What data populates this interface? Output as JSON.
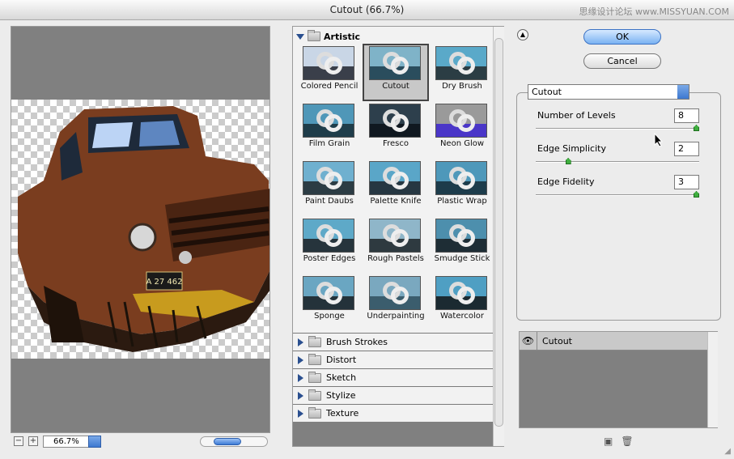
{
  "window": {
    "title": "Cutout (66.7%)",
    "watermark": "思缘设计论坛 www.MISSYUAN.COM"
  },
  "preview": {
    "zoom": "66.7%",
    "zoom_out_symbol": "−",
    "zoom_in_symbol": "+",
    "plate": "A 27 462"
  },
  "gallery": {
    "open_category": "Artistic",
    "filters": [
      {
        "label": "Colored Pencil",
        "sky": "#c9d6e6",
        "gnd": "#3a3f4a"
      },
      {
        "label": "Cutout",
        "sky": "#7fb3c8",
        "gnd": "#2a4d5d",
        "selected": true
      },
      {
        "label": "Dry Brush",
        "sky": "#5aa9c9",
        "gnd": "#2b3d44"
      },
      {
        "label": "Film Grain",
        "sky": "#4f97b8",
        "gnd": "#1f3d4a"
      },
      {
        "label": "Fresco",
        "sky": "#2d3f4c",
        "gnd": "#101820"
      },
      {
        "label": "Neon Glow",
        "sky": "#9a9a9a",
        "gnd": "#4a36c8"
      },
      {
        "label": "Paint Daubs",
        "sky": "#6fb0cf",
        "gnd": "#2c3c44"
      },
      {
        "label": "Palette Knife",
        "sky": "#5aa6c8",
        "gnd": "#263742"
      },
      {
        "label": "Plastic Wrap",
        "sky": "#4e98ba",
        "gnd": "#1d3c4b"
      },
      {
        "label": "Poster Edges",
        "sky": "#5ea9c8",
        "gnd": "#26343c"
      },
      {
        "label": "Rough Pastels",
        "sky": "#8fb6c9",
        "gnd": "#2e3a40"
      },
      {
        "label": "Smudge Stick",
        "sky": "#4d8fad",
        "gnd": "#1e2d35"
      },
      {
        "label": "Sponge",
        "sky": "#6aa6c2",
        "gnd": "#24323a"
      },
      {
        "label": "Underpainting",
        "sky": "#7aa8bf",
        "gnd": "#3b5d6d"
      },
      {
        "label": "Watercolor",
        "sky": "#4f9fc3",
        "gnd": "#1b2a31"
      }
    ],
    "categories": [
      "Brush Strokes",
      "Distort",
      "Sketch",
      "Stylize",
      "Texture"
    ]
  },
  "buttons": {
    "ok": "OK",
    "cancel": "Cancel"
  },
  "settings": {
    "filter": "Cutout",
    "params": [
      {
        "label": "Number of Levels",
        "value": "8",
        "level": 1.0
      },
      {
        "label": "Edge Simplicity",
        "value": "2",
        "level": 0.2
      },
      {
        "label": "Edge Fidelity",
        "value": "3",
        "level": 1.0
      }
    ]
  },
  "layers": {
    "items": [
      {
        "name": "Cutout"
      }
    ]
  },
  "colors": {
    "accent": "#3d78d0",
    "truck": "#7a3d1f"
  }
}
